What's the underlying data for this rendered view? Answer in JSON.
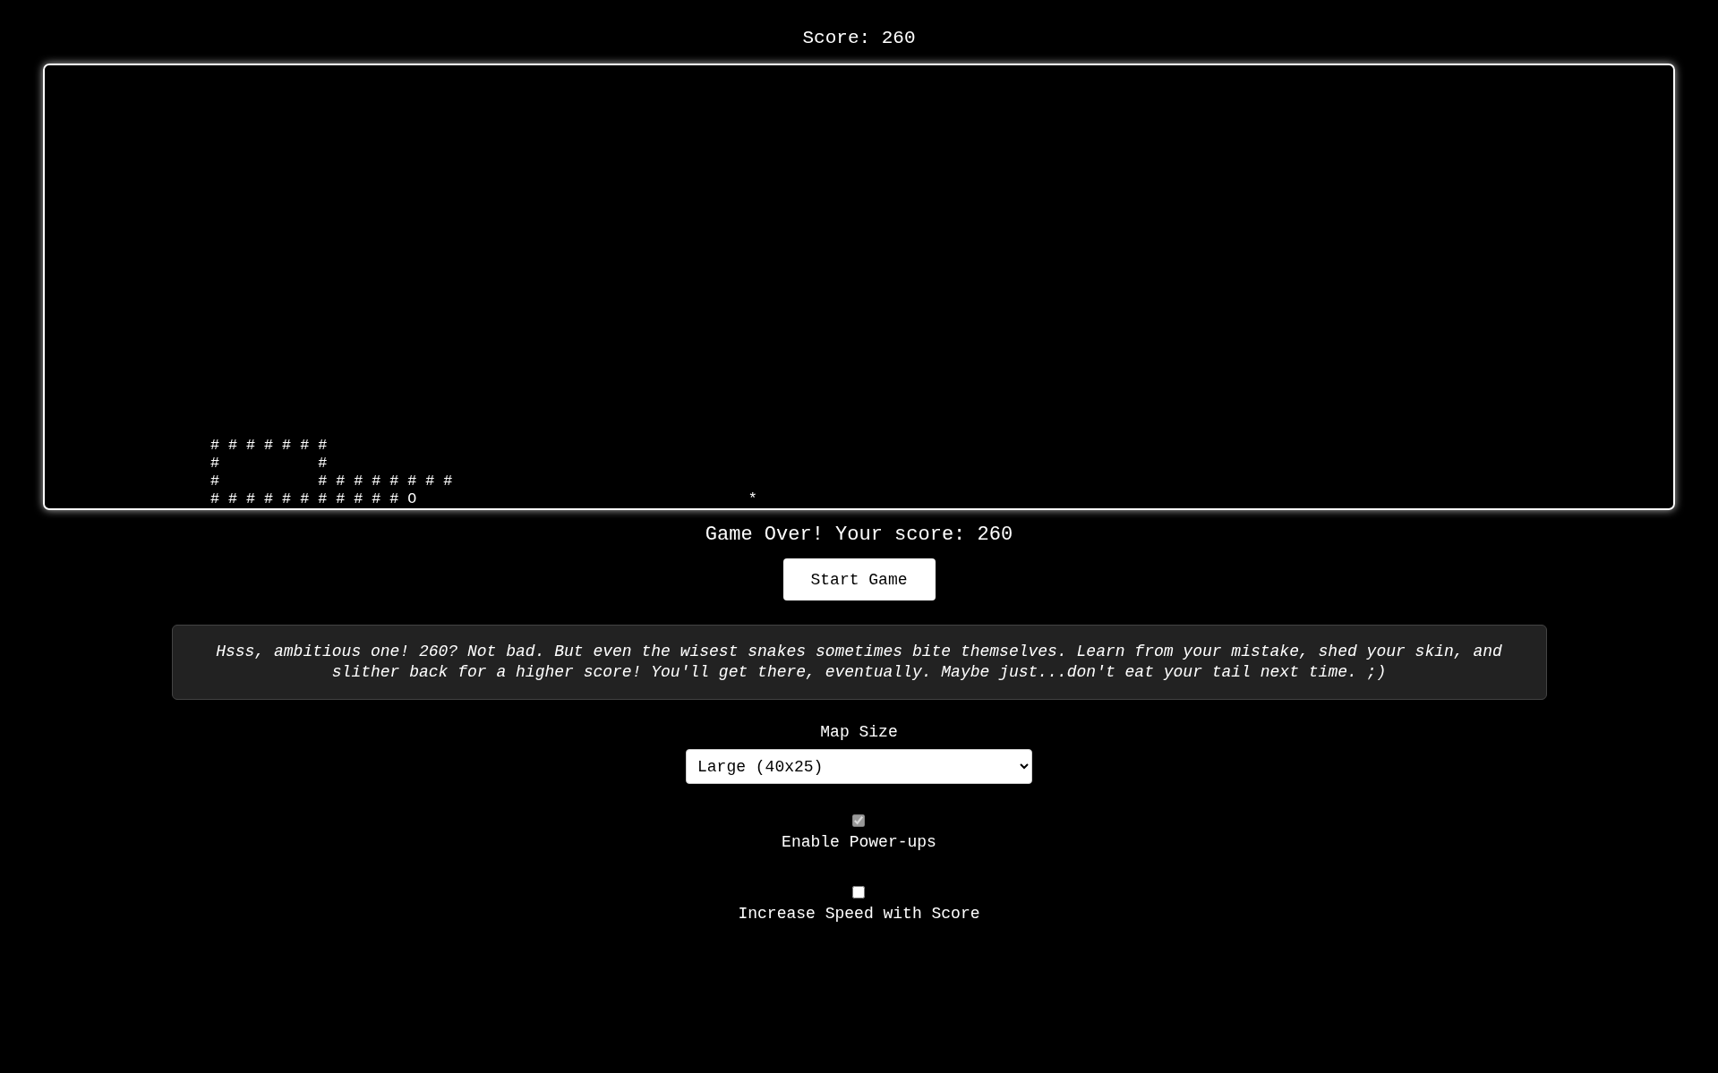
{
  "score_label": "Score: 260",
  "board": {
    "rows": [
      "# # # # # # #",
      "#           #",
      "#           # # # # # # # #",
      "# # # # # # # # # # # O                                     *"
    ]
  },
  "status": "Game Over! Your score: 260",
  "start_button": "Start Game",
  "message": "Hsss, ambitious one! 260? Not bad. But even the wisest snakes sometimes bite themselves. Learn from your mistake, shed your skin, and slither back for a higher score! You'll get there, eventually. Maybe just...don't eat your tail next time. ;)",
  "settings": [
    {
      "kind": "select",
      "label": "Map Size",
      "value": "Large (40x25)"
    },
    {
      "kind": "checkbox",
      "label": "Enable Power-ups",
      "checked": true,
      "disabled": true
    },
    {
      "kind": "checkbox",
      "label": "Increase Speed with Score",
      "checked": false,
      "disabled": false
    }
  ]
}
